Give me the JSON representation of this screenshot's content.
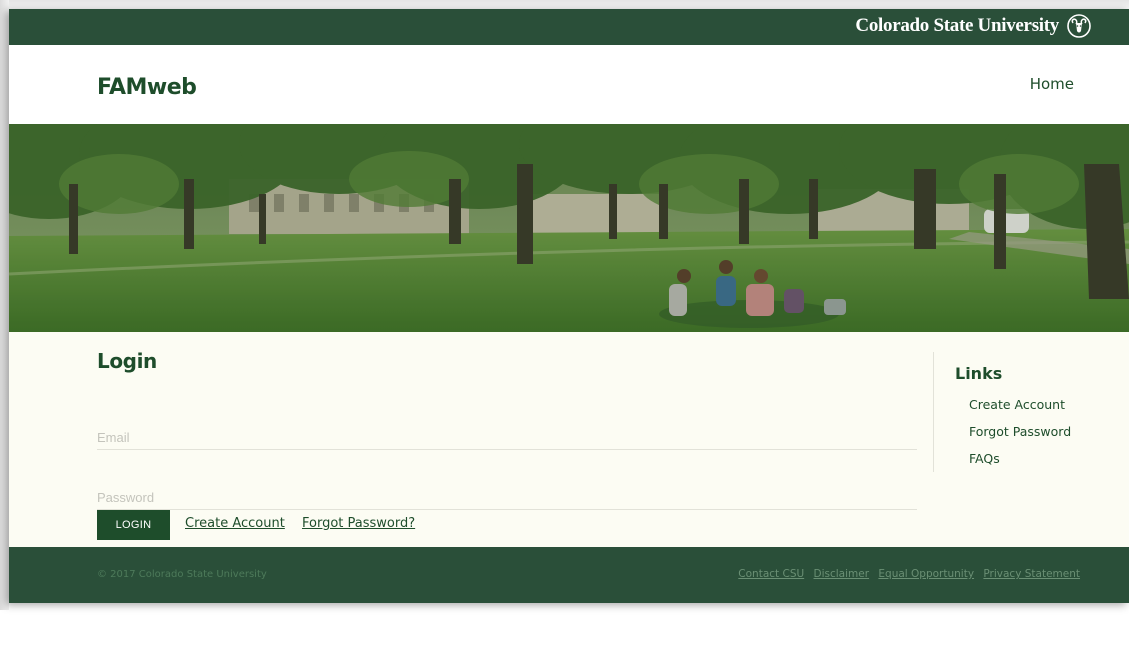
{
  "university_bar": {
    "name": "Colorado State University",
    "logo_icon": "csu-ram-icon"
  },
  "header": {
    "site_title": "FAMweb",
    "nav": [
      {
        "label": "Home"
      }
    ]
  },
  "login": {
    "heading": "Login",
    "email_placeholder": "Email",
    "email_value": "",
    "password_placeholder": "Password",
    "password_value": "",
    "login_button": "LOGIN",
    "create_account_link": "Create Account",
    "forgot_password_link": "Forgot Password?"
  },
  "sidebar": {
    "heading": "Links",
    "items": [
      {
        "label": "Create Account"
      },
      {
        "label": "Forgot Password"
      },
      {
        "label": "FAQs"
      }
    ]
  },
  "footer": {
    "copyright": "© 2017 Colorado State University",
    "links": [
      {
        "label": "Contact CSU"
      },
      {
        "label": "Disclaimer"
      },
      {
        "label": "Equal Opportunity"
      },
      {
        "label": "Privacy Statement"
      }
    ]
  },
  "colors": {
    "csu_green": "#1e4d2b",
    "bar_green": "#2a4f39",
    "page_background": "#fcfcf3",
    "footer_text": "#4d7a5a"
  }
}
